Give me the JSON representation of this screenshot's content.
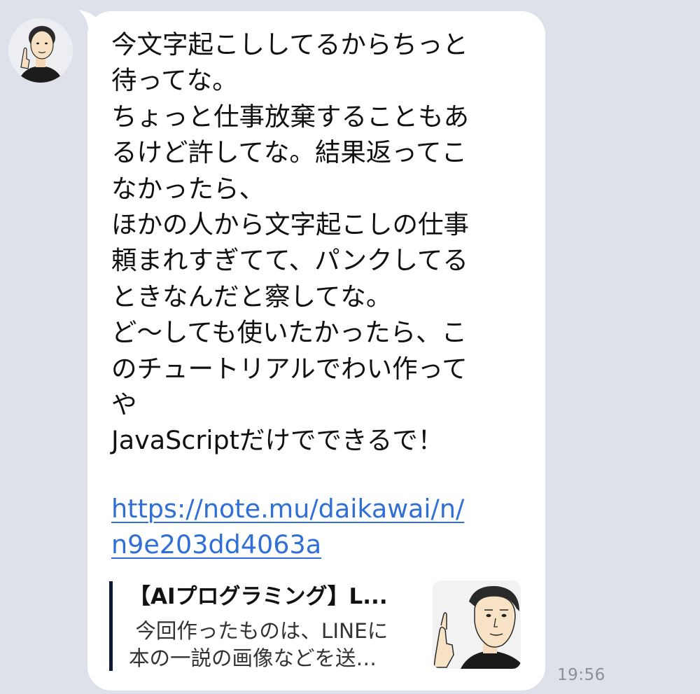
{
  "chat": {
    "message_text": "今文字起こししてるからちっと\n待ってな。\nちょっと仕事放棄することもあ\nるけど許してな。結果返ってこ\nなかったら、\nほかの人から文字起こしの仕事\n頼まれすぎてて、パンクしてる\nときなんだと察してな。\nど〜しても使いたかったら、こ\nのチュートリアルでわい作って\nや\nJavaScriptだけでできるで！",
    "link_text": "https://note.mu/daikawai/n/\nn9e203dd4063a",
    "preview": {
      "title": "【AIプログラミング】L...",
      "description": " 今回作ったものは、LINEに\n本の一説の画像などを送…"
    },
    "timestamp": "19:56"
  },
  "colors": {
    "background": "#dfe1ea",
    "bubble": "#ffffff",
    "link": "#2f6fd6",
    "preview_bar": "#0f1a35",
    "timestamp": "#8c8f98"
  },
  "icons": {
    "avatar": "sender-avatar",
    "thumbnail": "preview-thumbnail"
  }
}
